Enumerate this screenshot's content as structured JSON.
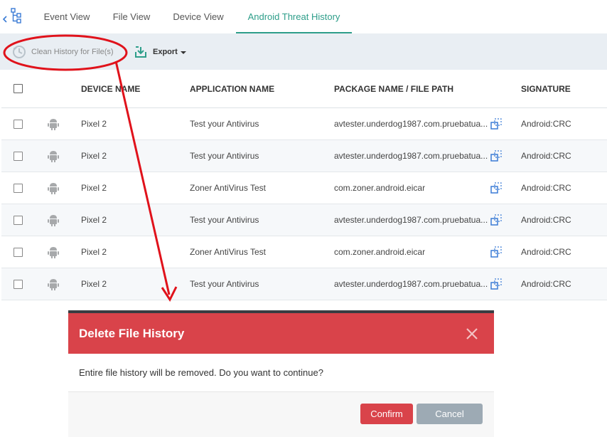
{
  "tabs": [
    {
      "label": "Event View"
    },
    {
      "label": "File View"
    },
    {
      "label": "Device View"
    },
    {
      "label": "Android Threat History"
    }
  ],
  "toolbar": {
    "clean_label": "Clean History for File(s)",
    "export_label": "Export"
  },
  "table": {
    "columns": [
      "DEVICE NAME",
      "APPLICATION NAME",
      "PACKAGE NAME / FILE PATH",
      "SIGNATURE"
    ],
    "rows": [
      {
        "device": "Pixel 2",
        "app": "Test your Antivirus",
        "package": "avtester.underdog1987.com.pruebatua...",
        "signature": "Android:CRC"
      },
      {
        "device": "Pixel 2",
        "app": "Test your Antivirus",
        "package": "avtester.underdog1987.com.pruebatua...",
        "signature": "Android:CRC"
      },
      {
        "device": "Pixel 2",
        "app": "Zoner AntiVirus Test",
        "package": "com.zoner.android.eicar",
        "signature": "Android:CRC"
      },
      {
        "device": "Pixel 2",
        "app": "Test your Antivirus",
        "package": "avtester.underdog1987.com.pruebatua...",
        "signature": "Android:CRC"
      },
      {
        "device": "Pixel 2",
        "app": "Zoner AntiVirus Test",
        "package": "com.zoner.android.eicar",
        "signature": "Android:CRC"
      },
      {
        "device": "Pixel 2",
        "app": "Test your Antivirus",
        "package": "avtester.underdog1987.com.pruebatua...",
        "signature": "Android:CRC"
      }
    ]
  },
  "dialog": {
    "title": "Delete File History",
    "message": "Entire file history will be removed. Do you want to continue?",
    "confirm_label": "Confirm",
    "cancel_label": "Cancel"
  },
  "colors": {
    "accent": "#2e9e8a",
    "danger": "#d9434a",
    "annotation": "#e0121b"
  },
  "icons": [
    "tree-view-icon",
    "clean-history-icon",
    "export-icon",
    "android-icon",
    "expand-path-icon",
    "close-icon"
  ]
}
